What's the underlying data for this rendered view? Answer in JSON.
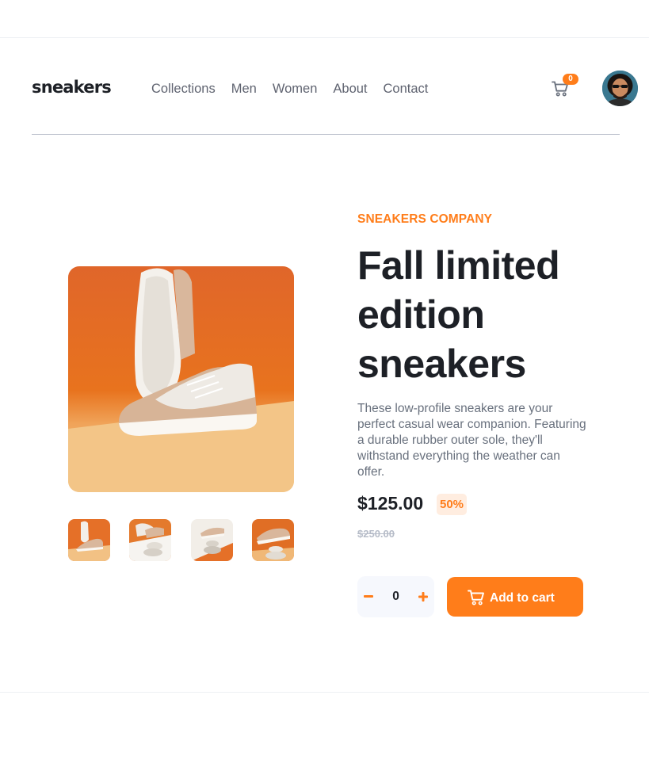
{
  "header": {
    "logo": "sneakers",
    "nav": [
      "Collections",
      "Men",
      "Women",
      "About",
      "Contact"
    ],
    "cart_count": "0"
  },
  "colors": {
    "accent": "#ff7d1a",
    "accent_pale": "#ffede0",
    "text_dark": "#1d2026",
    "text_gray": "#68707d",
    "muted": "#b6bcc8"
  },
  "product": {
    "company": "SNEAKERS COMPANY",
    "title": "Fall limited edition sneakers",
    "description": "These low-profile sneakers are your perfect casual wear companion. Featuring a durable rubber outer sole, they'll withstand everything the weather can offer.",
    "price": "$125.00",
    "discount": "50%",
    "old_price": "$250.00"
  },
  "gallery": {
    "thumbnail_count": 4
  },
  "quantity": {
    "value": "0"
  },
  "actions": {
    "add_to_cart": "Add to cart"
  },
  "icons": {
    "cart": "cart-icon",
    "minus": "minus-icon",
    "plus": "plus-icon"
  }
}
